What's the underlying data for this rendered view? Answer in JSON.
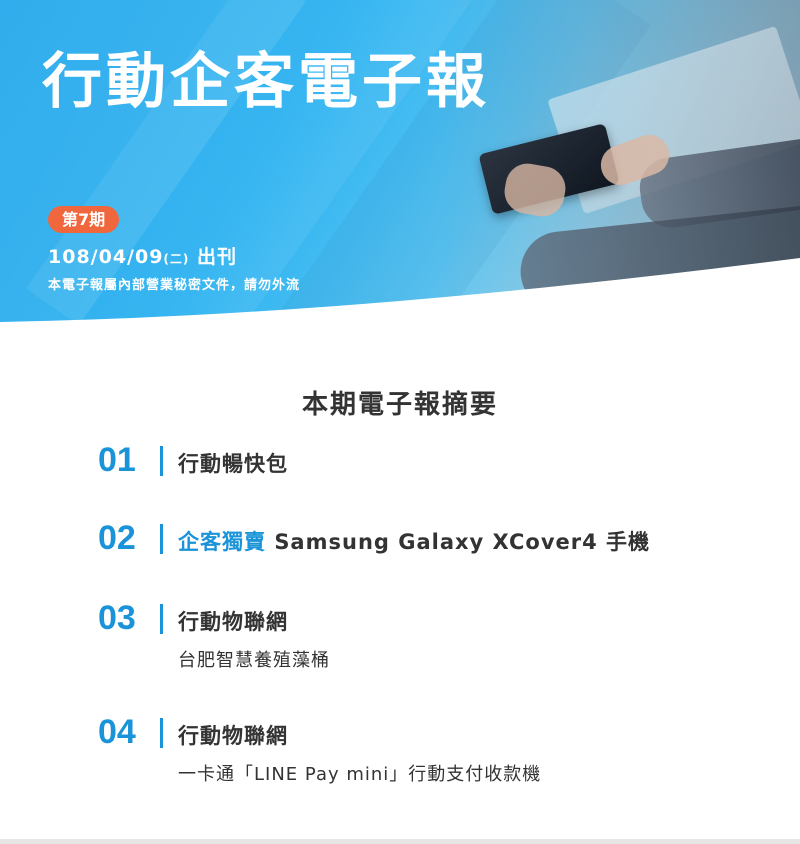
{
  "header": {
    "title": "行動企客電子報",
    "issue": "第7期",
    "date": "108/04/09",
    "weekday": "(二)",
    "date_suffix": "出刊",
    "notice": "本電子報屬內部營業秘密文件，請勿外流"
  },
  "summary": {
    "heading": "本期電子報摘要",
    "items": [
      {
        "number": "01",
        "title": "行動暢快包",
        "subtitle": ""
      },
      {
        "number": "02",
        "highlight": "企客獨賣",
        "title": "Samsung Galaxy XCover4 手機",
        "subtitle": ""
      },
      {
        "number": "03",
        "title": "行動物聯網",
        "subtitle": "台肥智慧養殖藻桶"
      },
      {
        "number": "04",
        "title": "行動物聯網",
        "subtitle": "一卡通「LINE Pay mini」行動支付收款機"
      }
    ]
  },
  "colors": {
    "accent": "#1a93d8",
    "badge": "#f0663d",
    "text": "#333333"
  }
}
